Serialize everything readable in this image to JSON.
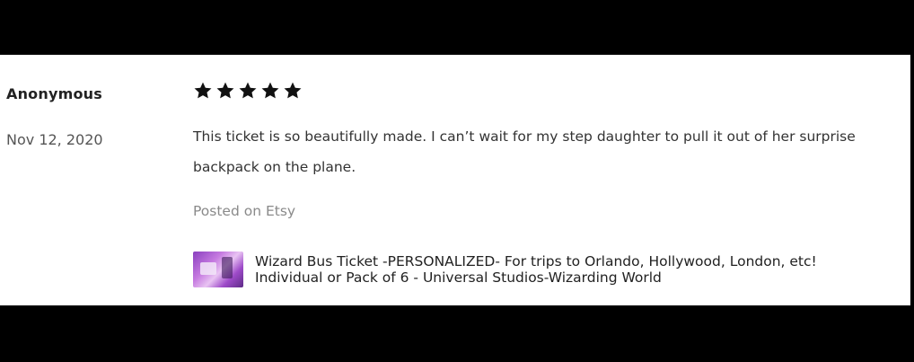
{
  "review": {
    "reviewer": "Anonymous",
    "date": "Nov 12, 2020",
    "rating": 5,
    "rating_max": 5,
    "text": "This ticket is so beautifully made. I can’t wait for my step daughter to pull it out of her surprise backpack on the plane.",
    "source": "Posted on Etsy"
  },
  "product": {
    "title_line1": "Wizard Bus Ticket -PERSONALIZED- For trips to Orlando, Hollywood, London, etc!",
    "title_line2": "Individual or Pack of 6 - Universal Studios-Wizarding World",
    "thumbnail_icon": "product-thumbnail-image"
  },
  "colors": {
    "background_band": "#000000",
    "panel": "#ffffff",
    "star": "#111111",
    "muted_text": "#8a8a8a"
  }
}
